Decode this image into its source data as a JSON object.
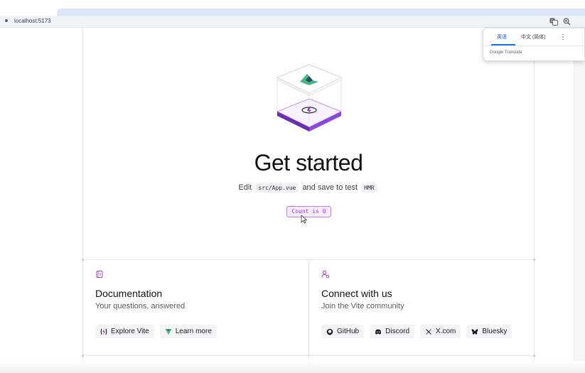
{
  "browser": {
    "url": "localhost:5173",
    "icons": [
      "translate-icon",
      "zoom-icon"
    ]
  },
  "translate_popup": {
    "tabs": [
      {
        "label": "英语",
        "active": true
      },
      {
        "label": "中文 (简体)",
        "active": false
      }
    ],
    "footer": "Google Translate",
    "menu_icon": "more-vertical-icon"
  },
  "main": {
    "headline": "Get started",
    "edit_prefix": "Edit",
    "edit_file": "src/App.vue",
    "edit_middle": "and save to test",
    "edit_hmr": "HMR",
    "count_button": "Count is 0"
  },
  "cards": {
    "documentation": {
      "icon": "book-icon",
      "title": "Documentation",
      "subtitle": "Your questions, answered",
      "links": [
        {
          "label": "Explore Vite",
          "icon": "vite-logo-icon"
        },
        {
          "label": "Learn more",
          "icon": "vue-logo-icon"
        }
      ]
    },
    "community": {
      "icon": "users-icon",
      "title": "Connect with us",
      "subtitle": "Join the Vite community",
      "links": [
        {
          "label": "GitHub",
          "icon": "github-icon"
        },
        {
          "label": "Discord",
          "icon": "discord-icon"
        },
        {
          "label": "X.com",
          "icon": "x-icon"
        },
        {
          "label": "Bluesky",
          "icon": "bluesky-icon"
        }
      ]
    }
  },
  "colors": {
    "accent": "#9a3fd1",
    "accent_border": "#bd7de6",
    "vue_green": "#42b883",
    "vue_dark": "#35495e",
    "vite_purple": "#7e3ec9"
  }
}
